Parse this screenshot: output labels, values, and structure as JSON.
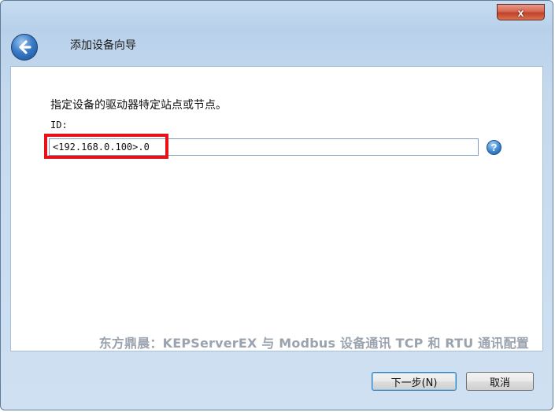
{
  "window": {
    "close_label": "x",
    "title": "添加设备向导"
  },
  "content": {
    "instruction": "指定设备的驱动器特定站点或节点。",
    "id_label": "ID:",
    "id_value": "<192.168.0.100>.0",
    "help_label": "?"
  },
  "watermark": "东方鼎晨：KEPServerEX 与 Modbus 设备通讯 TCP 和 RTU 通讯配置",
  "buttons": {
    "next": "下一步(N)",
    "cancel": "取消"
  },
  "colors": {
    "highlight": "#e8111a",
    "accent": "#3a7cc7"
  },
  "icons": {
    "back": "back-arrow-icon",
    "help": "help-icon",
    "close": "close-icon"
  }
}
